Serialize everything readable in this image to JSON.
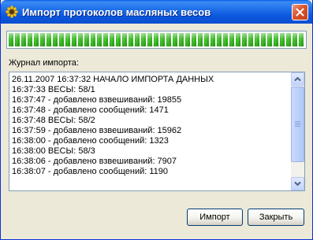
{
  "window": {
    "title": "Импорт протоколов масляных весов",
    "app_icon": "sunflower-icon",
    "close_icon": "close-icon",
    "colors": {
      "titlebar": "#0a56dc",
      "progress": "#2fb31a",
      "close": "#d9542f"
    }
  },
  "progress": {
    "fraction": 1.0
  },
  "log": {
    "label": "Журнал импорта:",
    "lines": [
      "26.11.2007 16:37:32 НАЧАЛО ИМПОРТА ДАННЫХ",
      "16:37:33 ВЕСЫ: 58/1",
      "16:37:47 - добавлено взвешиваний: 19855",
      "16:37:48 - добавлено сообщений: 1471",
      "16:37:48 ВЕСЫ: 58/2",
      "16:37:59 - добавлено взвешиваний: 15962",
      "16:38:00 - добавлено сообщений: 1323",
      "16:38:00 ВЕСЫ: 58/3",
      "16:38:06 - добавлено взвешиваний: 7907",
      "16:38:07 - добавлено сообщений: 1190"
    ]
  },
  "buttons": {
    "import_label": "Импорт",
    "close_label": "Закрыть"
  }
}
